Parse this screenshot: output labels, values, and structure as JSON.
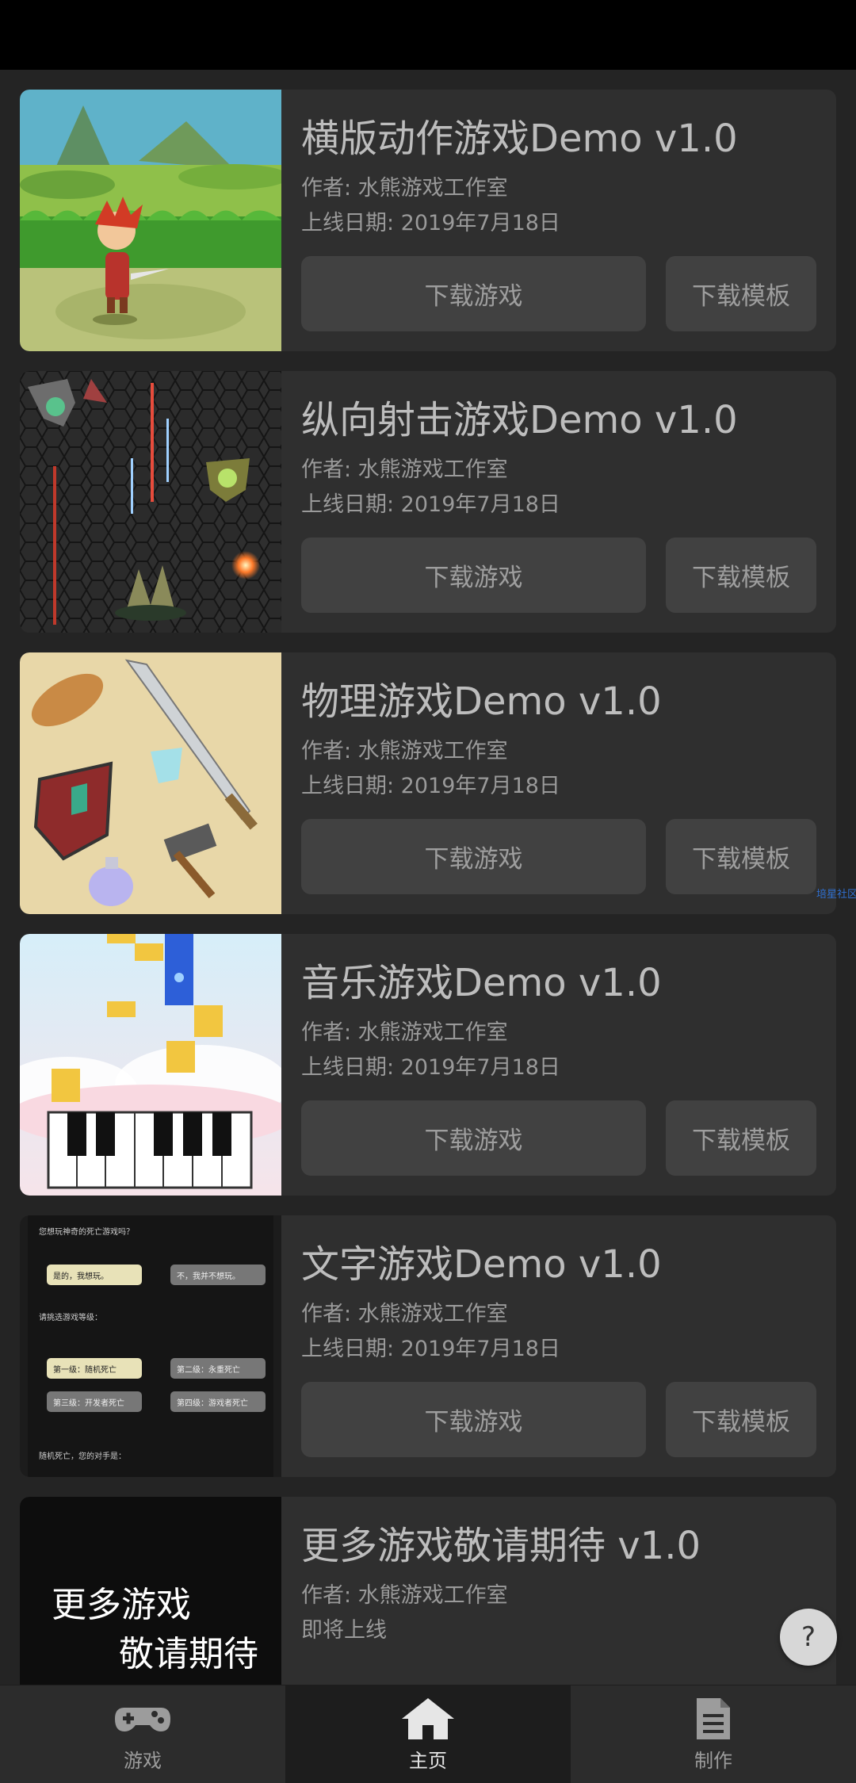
{
  "games": [
    {
      "title": "横版动作游戏Demo v1.0",
      "author": "作者: 水熊游戏工作室",
      "date": "上线日期: 2019年7月18日",
      "download_game": "下载游戏",
      "download_template": "下载模板"
    },
    {
      "title": "纵向射击游戏Demo v1.0",
      "author": "作者: 水熊游戏工作室",
      "date": "上线日期: 2019年7月18日",
      "download_game": "下载游戏",
      "download_template": "下载模板"
    },
    {
      "title": "物理游戏Demo v1.0",
      "author": "作者: 水熊游戏工作室",
      "date": "上线日期: 2019年7月18日",
      "download_game": "下载游戏",
      "download_template": "下载模板"
    },
    {
      "title": "音乐游戏Demo v1.0",
      "author": "作者: 水熊游戏工作室",
      "date": "上线日期: 2019年7月18日",
      "download_game": "下载游戏",
      "download_template": "下载模板"
    },
    {
      "title": "文字游戏Demo v1.0",
      "author": "作者: 水熊游戏工作室",
      "date": "上线日期: 2019年7月18日",
      "download_game": "下载游戏",
      "download_template": "下载模板"
    },
    {
      "title": "更多游戏敬请期待 v1.0",
      "author": "作者: 水熊游戏工作室",
      "date": "即将上线"
    }
  ],
  "text_game_thumb": {
    "question": "您想玩神奇的死亡游戏吗？",
    "yes": "是的，我想玩。",
    "no": "不，我并不想玩。",
    "choose_level": "请挑选游戏等级：",
    "level1": "第一级：随机死亡",
    "level2": "第二级：永重死亡",
    "level3": "第三级：开发者死亡",
    "level4": "第四级：游戏者死亡",
    "result": "随机死亡，您的对手是："
  },
  "more_thumb": {
    "line1": "更多游戏",
    "line2": "敬请期待"
  },
  "watermark": "培星社区",
  "help_label": "?",
  "nav": [
    {
      "label": "游戏",
      "icon": "gamepad-icon"
    },
    {
      "label": "主页",
      "icon": "home-icon",
      "active": true
    },
    {
      "label": "制作",
      "icon": "document-icon"
    }
  ]
}
